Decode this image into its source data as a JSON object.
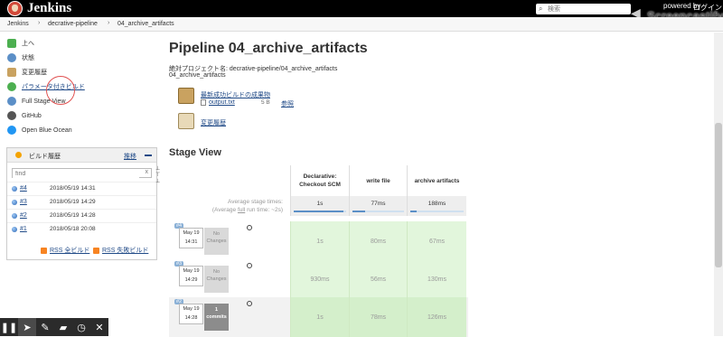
{
  "header": {
    "logo_text": "Jenkins",
    "search_placeholder": "検索",
    "screencastify_powered": "powered by",
    "screencastify_name": "Screencastify",
    "login_label": "ログイン"
  },
  "breadcrumb": [
    "Jenkins",
    "decrative-pipeline",
    "04_archive_artifacts"
  ],
  "sidebar": {
    "tasks": [
      {
        "label": "上へ",
        "icon": "up-arrow-icon",
        "color": "#4caf50"
      },
      {
        "label": "状態",
        "icon": "magnifier-icon",
        "color": "#5b8fc7"
      },
      {
        "label": "変更履歴",
        "icon": "notepad-icon",
        "color": "#c9a260"
      },
      {
        "label": "パラメータ付きビルド",
        "icon": "build-clock-icon",
        "color": "#4caf50"
      },
      {
        "label": "Full Stage View",
        "icon": "magnifier-icon",
        "color": "#5b8fc7"
      },
      {
        "label": "GitHub",
        "icon": "github-icon",
        "color": "#333333"
      },
      {
        "label": "Open Blue Ocean",
        "icon": "blue-ocean-icon",
        "color": "#2196f3"
      }
    ],
    "build_history": {
      "title": "ビルド履歴",
      "trend": "推移",
      "filter_value": "find",
      "filter_clear": "x",
      "builds": [
        {
          "num": "#4",
          "date": "2018/05/19 14:31"
        },
        {
          "num": "#3",
          "date": "2018/05/19 14:29"
        },
        {
          "num": "#2",
          "date": "2018/05/19 14:28"
        },
        {
          "num": "#1",
          "date": "2018/05/18 20:08"
        }
      ],
      "rss_all": "RSS 全ビルド",
      "rss_failed": "RSS 失敗ビルド"
    }
  },
  "main": {
    "title": "Pipeline 04_archive_artifacts",
    "full_name": "絶対プロジェクト名: decrative-pipeline/04_archive_artifacts",
    "short_name": "04_archive_artifacts",
    "artifacts_title": "最新成功ビルドの成果物",
    "file_name": "output.txt",
    "file_size": "5 B",
    "file_view": "参照",
    "changes_label": "変更履歴"
  },
  "stage_view": {
    "title": "Stage View",
    "avg_label_1": "Average stage times:",
    "avg_label_2a": "(Average ",
    "avg_label_2b": "full",
    "avg_label_2c": " run time: ~2s)",
    "stages": [
      {
        "name": "Declarative: Checkout SCM",
        "avg": "1s",
        "fill": 0.95
      },
      {
        "name": "write file",
        "avg": "77ms",
        "fill": 0.25
      },
      {
        "name": "archive artifacts",
        "avg": "188ms",
        "fill": 0.12
      }
    ],
    "runs": [
      {
        "num": "#4",
        "date": "May 19",
        "time": "14:31",
        "changes": "No Changes",
        "cells": [
          "1s",
          "80ms",
          "67ms"
        ]
      },
      {
        "num": "#3",
        "date": "May 19",
        "time": "14:29",
        "changes": "No Changes",
        "cells": [
          "930ms",
          "56ms",
          "130ms"
        ]
      },
      {
        "num": "#2",
        "date": "May 19",
        "time": "14:28",
        "changes": "1 commits",
        "cells": [
          "1s",
          "78ms",
          "126ms"
        ]
      }
    ]
  },
  "recorder": {
    "buttons": [
      "pause-icon",
      "pointer-icon",
      "pen-icon",
      "eraser-icon",
      "timer-icon",
      "close-icon"
    ]
  }
}
